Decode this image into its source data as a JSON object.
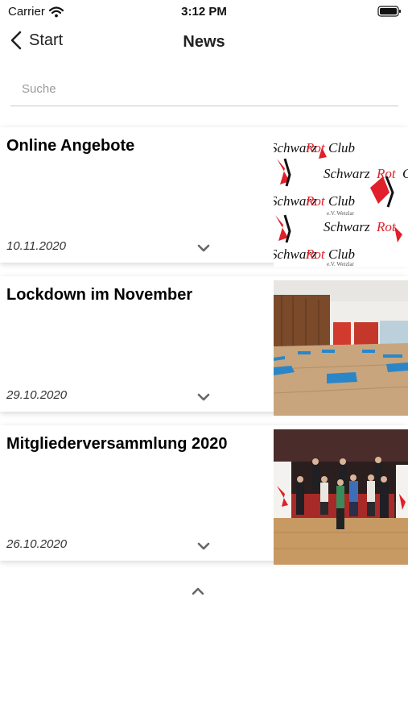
{
  "status_bar": {
    "carrier": "Carrier",
    "time": "3:12 PM"
  },
  "nav": {
    "back_label": "Start",
    "title": "News"
  },
  "search": {
    "placeholder": "Suche",
    "value": ""
  },
  "news": [
    {
      "title": "Online Angebote",
      "date": "10.11.2020",
      "image": "schwarz-rot-club-logo-pattern"
    },
    {
      "title": "Lockdown im November",
      "date": "29.10.2020",
      "image": "gym-hall-with-mats-photo"
    },
    {
      "title": "Mitgliederversammlung 2020",
      "date": "26.10.2020",
      "image": "group-photo-on-dance-floor"
    }
  ],
  "logo_text": {
    "word1": "Schwarz",
    "word2": "Rot",
    "word3": "Club",
    "sub": "e.V. Wetzlar"
  },
  "icons": {
    "wifi": "wifi-icon",
    "battery": "battery-icon",
    "back": "chevron-left-icon",
    "expand": "chevron-down-icon",
    "collapse": "chevron-up-icon"
  },
  "colors": {
    "accent_red": "#e0202a",
    "text": "#000000",
    "muted": "#9a9a9a"
  }
}
